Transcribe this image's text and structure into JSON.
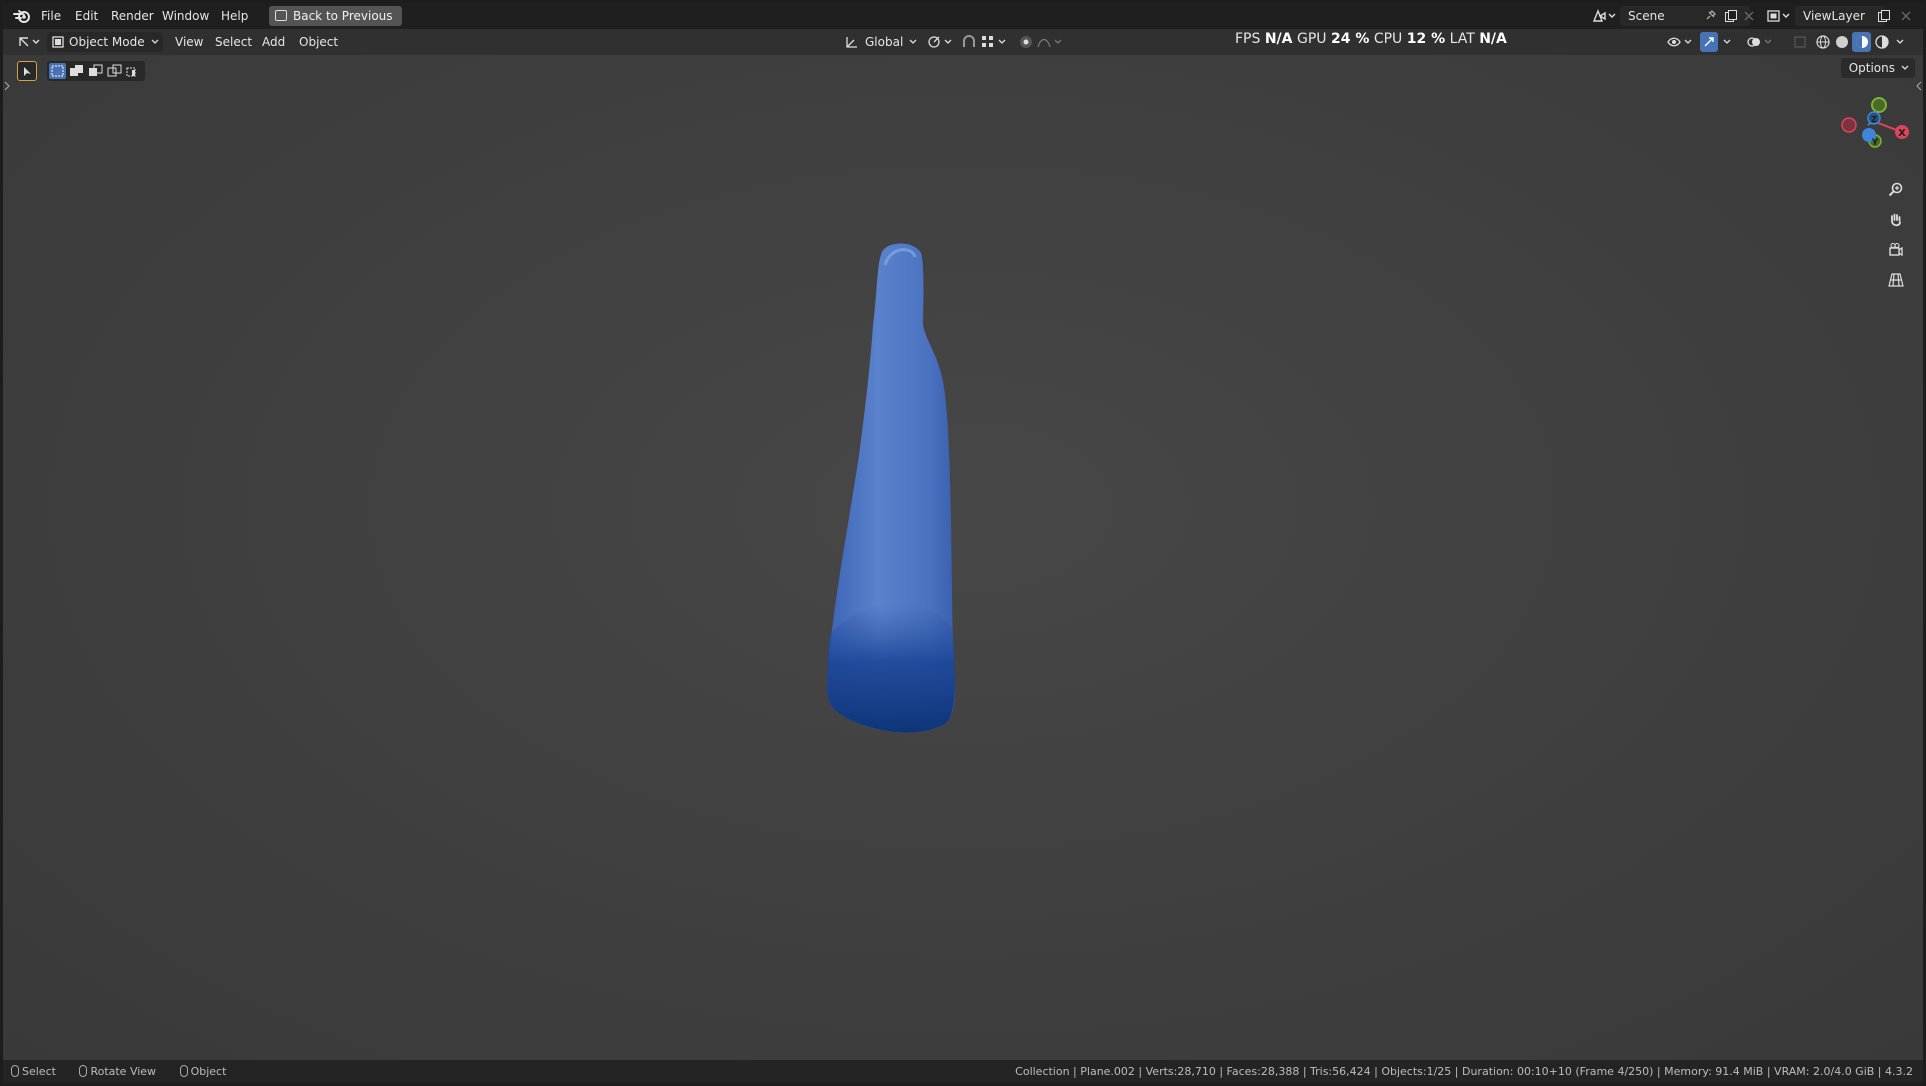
{
  "menu": {
    "items": [
      "File",
      "Edit",
      "Render",
      "Window",
      "Help"
    ],
    "back_to_previous": "Back to Previous"
  },
  "scene": {
    "name": "Scene"
  },
  "view_layer": {
    "name": "ViewLayer"
  },
  "header": {
    "mode": "Object Mode",
    "menus": [
      "View",
      "Select",
      "Add",
      "Object"
    ],
    "transform_orientation": "Global"
  },
  "stats": {
    "fps_label": "FPS",
    "fps_value": "N/A",
    "gpu_label": "GPU",
    "gpu_value": "24 %",
    "cpu_label": "CPU",
    "cpu_value": "12 %",
    "lat_label": "LAT",
    "lat_value": "N/A"
  },
  "viewport": {
    "options_label": "Options",
    "object_color": "#3f6fc4",
    "gizmo_colors": {
      "x": "#e0435b",
      "y": "#7bb531",
      "z": "#3f86d8"
    },
    "gizmo_labels": {
      "x": "X",
      "y": "Y",
      "z": "Z"
    }
  },
  "statusbar": {
    "hint_select": "Select",
    "hint_rotate": "Rotate View",
    "hint_object": "Object",
    "info": "Collection | Plane.002 | Verts:28,710 | Faces:28,388 | Tris:56,424 | Objects:1/25 | Duration: 00:10+10 (Frame 4/250) | Memory: 91.4 MiB | VRAM: 2.0/4.0 GiB | 4.3.2"
  }
}
